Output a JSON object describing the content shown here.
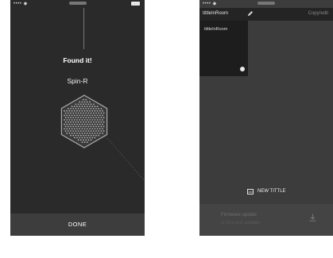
{
  "colors": {
    "phone1_bg": "#2a2a2a",
    "phone2_bg": "#3c3c3c",
    "hex_stroke": "#aaaaaa",
    "hex_fill": "#3a3a3a",
    "dot": "#b8b8b8"
  },
  "screen1": {
    "status": {
      "left": "•••• ◆"
    },
    "found_text": "Found it!",
    "device_name": "Spin-R",
    "hex_icon": "hexagon-speaker-grille-icon",
    "done_label": "DONE"
  },
  "screen2": {
    "status": {
      "left": "•••• ◆"
    },
    "room_tab": "tittleInRoom",
    "edit_icon": "pencil-icon",
    "copy_label": "Copy/edit",
    "room_card_label": "tittleInRoom",
    "check_icon": "check-icon",
    "new_title_label": "NEW TITTLE",
    "firmware_title": "Firmware update",
    "firmware_sub": "(1.15 a.com) available",
    "download_icon": "download-icon"
  }
}
